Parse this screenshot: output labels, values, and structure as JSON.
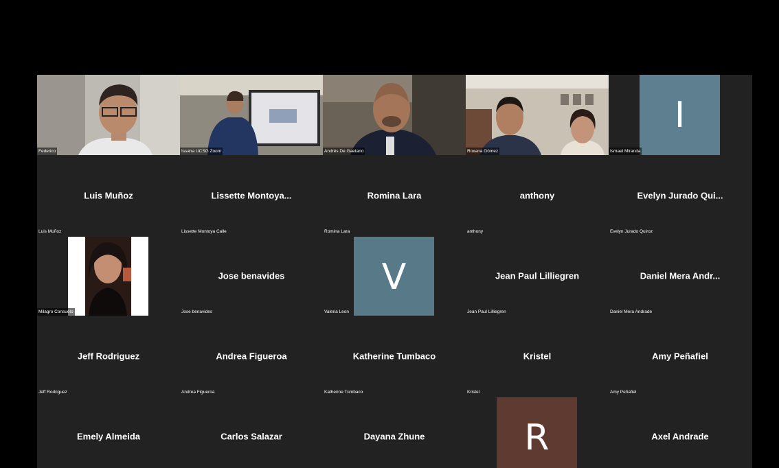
{
  "tiles_row1": [
    {
      "label": "Federico"
    },
    {
      "label": "Issaha UCSG Zoom"
    },
    {
      "label": "Andrés De Gaetano"
    },
    {
      "label": "Roxana Gómez"
    },
    {
      "label": "Ismael Miranda",
      "initial": "I",
      "color": "#5d7f90"
    }
  ],
  "tiles_row2": [
    {
      "name": "Luis Muñoz",
      "label": "Luis Muñoz"
    },
    {
      "name": "Lissette  Montoya...",
      "label": "Lissette Montoya Calle"
    },
    {
      "name": "Romina Lara",
      "label": "Romina Lara"
    },
    {
      "name": "anthony",
      "label": "anthony"
    },
    {
      "name": "Evelyn  Jurado  Qui...",
      "label": "Evelyn Jurado Quiroz"
    }
  ],
  "tiles_row3": [
    {
      "label": "Milagro Consuelo"
    },
    {
      "name": "Jose benavides",
      "label": "Jose benavides"
    },
    {
      "label": "Valeria Leon",
      "initial": "V",
      "color": "#587987"
    },
    {
      "name": "Jean Paul Lilliegren",
      "label": "Jean Paul Lilliegren"
    },
    {
      "name": "Daniel  Mera  Andr...",
      "label": "Daniel Mera Andrade"
    }
  ],
  "tiles_row4": [
    {
      "name": "Jeff Rodriguez",
      "label": "Jeff Rodriguez"
    },
    {
      "name": "Andrea Figueroa",
      "label": "Andrea Figueroa"
    },
    {
      "name": "Katherine Tumbaco",
      "label": "Katherine Tumbaco"
    },
    {
      "name": "Kristel",
      "label": "Kristel"
    },
    {
      "name": "Amy Peñafiel",
      "label": "Amy Peñafiel"
    }
  ],
  "tiles_row5": [
    {
      "name": "Emely Almeida"
    },
    {
      "name": "Carlos Salazar"
    },
    {
      "name": "Dayana Zhune"
    },
    {
      "initial": "R",
      "color": "#5e3a30"
    },
    {
      "name": "Axel Andrade"
    }
  ]
}
